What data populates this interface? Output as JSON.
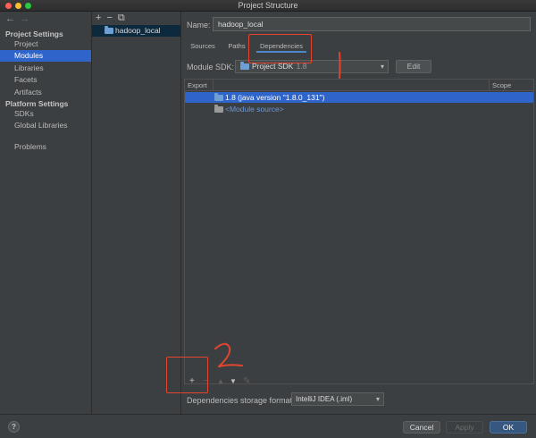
{
  "window": {
    "title": "Project Structure"
  },
  "nav": {
    "back": "←",
    "forward": "→"
  },
  "sidebar": {
    "project_settings_header": "Project Settings",
    "platform_settings_header": "Platform Settings",
    "items": [
      {
        "label": "Project"
      },
      {
        "label": "Modules",
        "selected": true
      },
      {
        "label": "Libraries"
      },
      {
        "label": "Facets"
      },
      {
        "label": "Artifacts"
      },
      {
        "label": "SDKs"
      },
      {
        "label": "Global Libraries"
      },
      {
        "label": "Problems"
      }
    ]
  },
  "modules": {
    "add": "+",
    "remove": "−",
    "copy": "⧉",
    "items": [
      {
        "label": "hadoop_local",
        "selected": true
      }
    ]
  },
  "module": {
    "name_label": "Name:",
    "name_value": "hadoop_local",
    "tabs": [
      {
        "label": "Sources"
      },
      {
        "label": "Paths"
      },
      {
        "label": "Dependencies",
        "active": true
      }
    ],
    "sdk_label": "Module SDK:",
    "sdk_value": "Project SDK",
    "sdk_version": "1.8",
    "edit_label": "Edit"
  },
  "dependencies": {
    "columns": {
      "export": "Export",
      "scope": "Scope"
    },
    "rows": [
      {
        "label": "1.8 (java version \"1.8.0_131\")",
        "selected": true
      },
      {
        "label": "<Module source>"
      }
    ],
    "toolbar": {
      "add": "+",
      "remove": "−",
      "up": "▲",
      "down": "▼",
      "edit": "✎"
    },
    "storage_label": "Dependencies storage format:",
    "storage_value": "IntelliJ IDEA (.iml)"
  },
  "footer": {
    "help": "?",
    "cancel": "Cancel",
    "apply": "Apply",
    "ok": "OK"
  },
  "annotations": {
    "mark_1": "1",
    "mark_2": "2"
  },
  "colors": {
    "background": "#3c3f41",
    "selection": "#2f65ca",
    "annotation": "#e2452f",
    "ok_button": "#365880"
  }
}
